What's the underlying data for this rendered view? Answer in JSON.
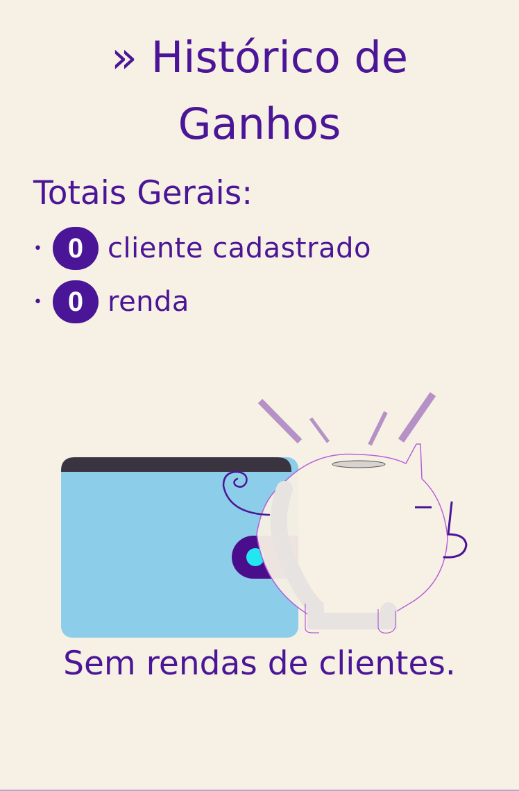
{
  "header": {
    "title_line1": "» Histórico de",
    "title_line2": "Ganhos"
  },
  "totals": {
    "heading": "Totais Gerais:",
    "items": [
      {
        "bullet": "•",
        "count": "0",
        "label": "cliente cadastrado"
      },
      {
        "bullet": "•",
        "count": "0",
        "label": "renda"
      }
    ]
  },
  "illustration": {
    "icons": [
      "wallet-icon",
      "piggy-bank-icon"
    ],
    "colors": {
      "wallet_body": "#8ccdea",
      "wallet_top": "#3a3340",
      "wallet_clasp": "#4a0d8c",
      "clasp_button": "#22e6f0",
      "pig_outline": "#b45ad8",
      "accent": "#4a1596"
    }
  },
  "empty_state": {
    "message": "Sem rendas de clientes."
  }
}
